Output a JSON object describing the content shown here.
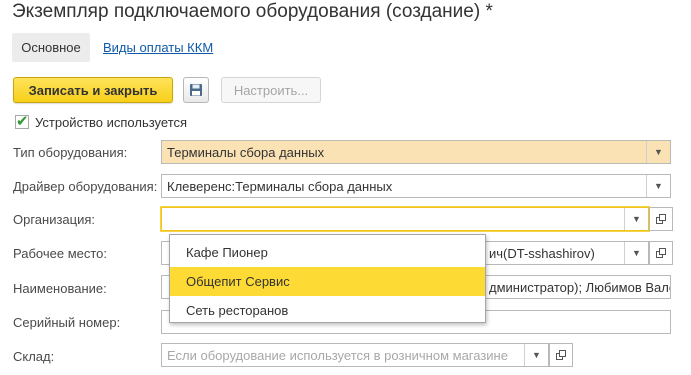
{
  "window": {
    "title": "Экземпляр подключаемого оборудования (создание) *"
  },
  "tabs": [
    {
      "label": "Основное"
    },
    {
      "label": "Виды оплаты ККМ"
    }
  ],
  "toolbar": {
    "save_close_label": "Записать и закрыть",
    "save_icon": "floppy-disk-icon",
    "configure_label": "Настроить..."
  },
  "device_used": {
    "label": "Устройство используется",
    "checked": true
  },
  "form": {
    "equipment_type": {
      "label": "Тип оборудования:",
      "value": "Терминалы сбора данных"
    },
    "driver": {
      "label": "Драйвер оборудования:",
      "value": "Клеверенс:Терминалы сбора данных"
    },
    "organization": {
      "label": "Организация:",
      "value": ""
    },
    "workplace": {
      "label": "Рабочее место:",
      "value_visible": "ич(DT-sshashirov)"
    },
    "name": {
      "label": "Наименование:",
      "value_visible": "дминистратор); Любимов Вале"
    },
    "serial": {
      "label": "Серийный номер:",
      "value": ""
    },
    "warehouse": {
      "label": "Склад:",
      "placeholder": "Если оборудование используется в розничном магазине"
    }
  },
  "dropdown": {
    "items": [
      {
        "label": "Кафе Пионер",
        "selected": false
      },
      {
        "label": "Общепит Сервис",
        "selected": true
      },
      {
        "label": "Сеть ресторанов",
        "selected": false
      }
    ]
  },
  "colors": {
    "accent_yellow": "#f7cf1a",
    "highlight_field": "#fbe2b4",
    "link": "#0f5aa8",
    "selected_item": "#fddb34"
  }
}
